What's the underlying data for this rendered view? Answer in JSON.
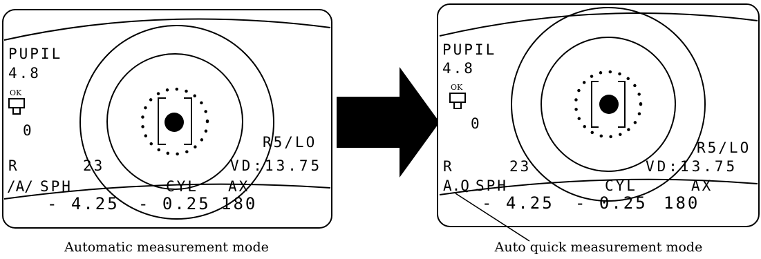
{
  "panels": [
    {
      "caption": "Automatic measurement mode",
      "pupil_label": "PUPIL",
      "pupil_value": "4.8",
      "ok_label": "OK",
      "count": "0",
      "program": "R5/LO",
      "eye": "R",
      "eye_value": "23",
      "vd": "VD:13.75",
      "mode": "/A/",
      "sph_label": "SPH",
      "cyl_label": "CYL",
      "ax_label": "AX",
      "sph_value": "- 4.25",
      "cyl_value": "- 0.25",
      "ax_value": "180"
    },
    {
      "caption": "Auto quick measurement mode",
      "pupil_label": "PUPIL",
      "pupil_value": "4.8",
      "ok_label": "OK",
      "count": "0",
      "program": "R5/LO",
      "eye": "R",
      "eye_value": "23",
      "vd": "VD:13.75",
      "mode": "A.Q",
      "sph_label": "SPH",
      "cyl_label": "CYL",
      "ax_label": "AX",
      "sph_value": "- 4.25",
      "cyl_value": "- 0.25",
      "ax_value": "180"
    }
  ],
  "colors": {
    "ink": "#000000",
    "paper": "#ffffff"
  }
}
